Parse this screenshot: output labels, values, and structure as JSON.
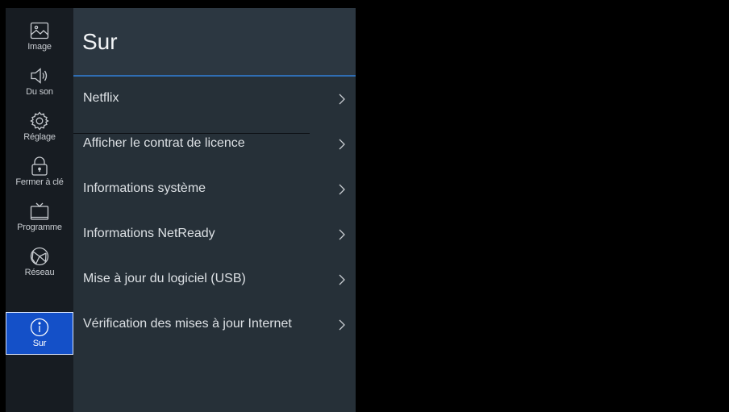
{
  "sidebar": {
    "items": [
      {
        "label": "Image",
        "icon": "image-icon"
      },
      {
        "label": "Du son",
        "icon": "speaker-icon"
      },
      {
        "label": "Réglage",
        "icon": "gear-icon"
      },
      {
        "label": "Fermer à clé",
        "icon": "lock-icon"
      },
      {
        "label": "Programme",
        "icon": "tv-icon"
      },
      {
        "label": "Réseau",
        "icon": "network-globe-icon"
      },
      {
        "label": "Sur",
        "icon": "info-icon",
        "active": true
      }
    ]
  },
  "panel": {
    "title": "Sur",
    "items": [
      {
        "label": "Netflix",
        "arrow": ">"
      },
      {
        "label": "Afficher le contrat de licence",
        "arrow": ">"
      },
      {
        "label": "Informations système",
        "arrow": ">"
      },
      {
        "label": "Informations NetReady",
        "arrow": ">"
      },
      {
        "label": "Mise à jour du logiciel (USB)",
        "arrow": ">"
      },
      {
        "label": "Vérification des mises à jour Internet",
        "arrow": ">"
      }
    ]
  },
  "colors": {
    "active_tab": "#1450c8",
    "header_underline": "#2f6db3"
  }
}
